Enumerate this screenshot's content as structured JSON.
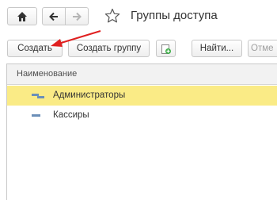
{
  "header": {
    "title": "Группы доступа"
  },
  "toolbar": {
    "create_label": "Создать",
    "create_group_label": "Создать группу",
    "find_label": "Найти...",
    "cancel_search_label": "Отме"
  },
  "table": {
    "column_header": "Наименование",
    "rows": [
      {
        "label": "Администраторы",
        "selected": true
      },
      {
        "label": "Кассиры",
        "selected": false
      }
    ]
  },
  "colors": {
    "selected_row": "#faeb86",
    "annotation_arrow": "#e02020"
  }
}
